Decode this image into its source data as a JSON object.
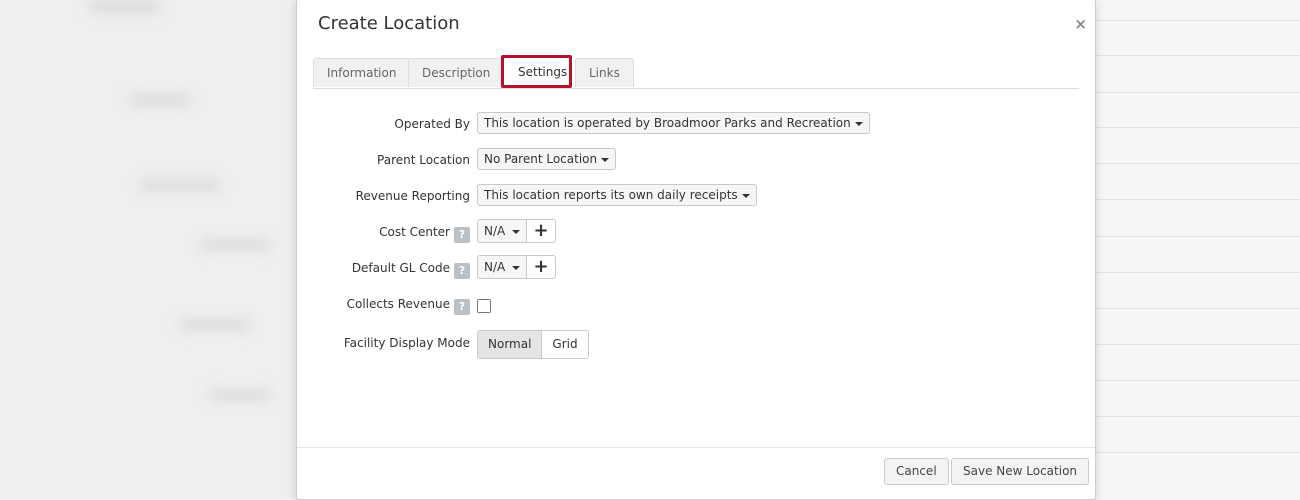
{
  "modal": {
    "title": "Create Location",
    "close_glyph": "×"
  },
  "tabs": [
    {
      "label": "Information",
      "active": false
    },
    {
      "label": "Description",
      "active": false
    },
    {
      "label": "Settings",
      "active": true
    },
    {
      "label": "Links",
      "active": false
    }
  ],
  "form": {
    "operated_by": {
      "label": "Operated By",
      "value": "This location is operated by Broadmoor Parks and Recreation"
    },
    "parent_location": {
      "label": "Parent Location",
      "value": "No Parent Location"
    },
    "revenue_reporting": {
      "label": "Revenue Reporting",
      "value": "This location reports its own daily receipts"
    },
    "cost_center": {
      "label": "Cost Center",
      "value": "N/A",
      "help": "?",
      "add_glyph": "+"
    },
    "default_gl_code": {
      "label": "Default GL Code",
      "value": "N/A",
      "help": "?",
      "add_glyph": "+"
    },
    "collects_revenue": {
      "label": "Collects Revenue",
      "help": "?",
      "checked": false
    },
    "facility_display_mode": {
      "label": "Facility Display Mode",
      "options": [
        "Normal",
        "Grid"
      ],
      "selected": "Normal"
    }
  },
  "footer": {
    "cancel_label": "Cancel",
    "save_label": "Save New Location"
  },
  "colors": {
    "highlight": "#b5112c"
  }
}
